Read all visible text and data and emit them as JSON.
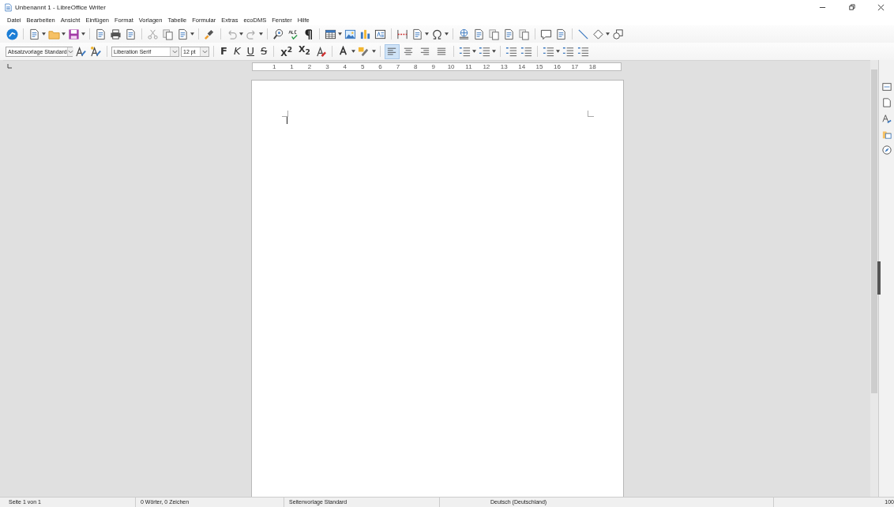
{
  "window": {
    "title": "Unbenannt 1 - LibreOffice Writer"
  },
  "menu": [
    "Datei",
    "Bearbeiten",
    "Ansicht",
    "Einfügen",
    "Format",
    "Vorlagen",
    "Tabelle",
    "Formular",
    "Extras",
    "ecoDMS",
    "Fenster",
    "Hilfe"
  ],
  "formatting": {
    "paragraph_style": "Absatzvorlage Standard",
    "font": "Liberation Serif",
    "size": "12 pt",
    "text_buttons": [
      {
        "label": "F",
        "kind": "bold"
      },
      {
        "label": "K",
        "kind": "italic"
      },
      {
        "label": "U",
        "kind": "underline"
      },
      {
        "label": "S",
        "kind": "strike"
      },
      {
        "label": "X$^{2}$",
        "kind": "script"
      },
      {
        "label": "X$_{2}$",
        "kind": "script"
      }
    ],
    "alignment": [
      {
        "selected": true
      },
      {
        "selected": false
      },
      {
        "selected": false
      },
      {
        "selected": false
      }
    ]
  },
  "ruler": {
    "labels": [
      "1",
      "1",
      "2",
      "3",
      "4",
      "5",
      "6",
      "7",
      "8",
      "9",
      "10",
      "11",
      "12",
      "13",
      "14",
      "15",
      "16",
      "17",
      "18"
    ]
  },
  "status_bar": [
    {
      "text": "Seite 1 von 1"
    },
    {
      "text": "0 Wörter, 0 Zeichen"
    },
    {
      "text": "Seitenvorlage Standard"
    },
    {
      "text": "Deutsch (Deutschland)"
    },
    {
      "text": "100"
    }
  ]
}
